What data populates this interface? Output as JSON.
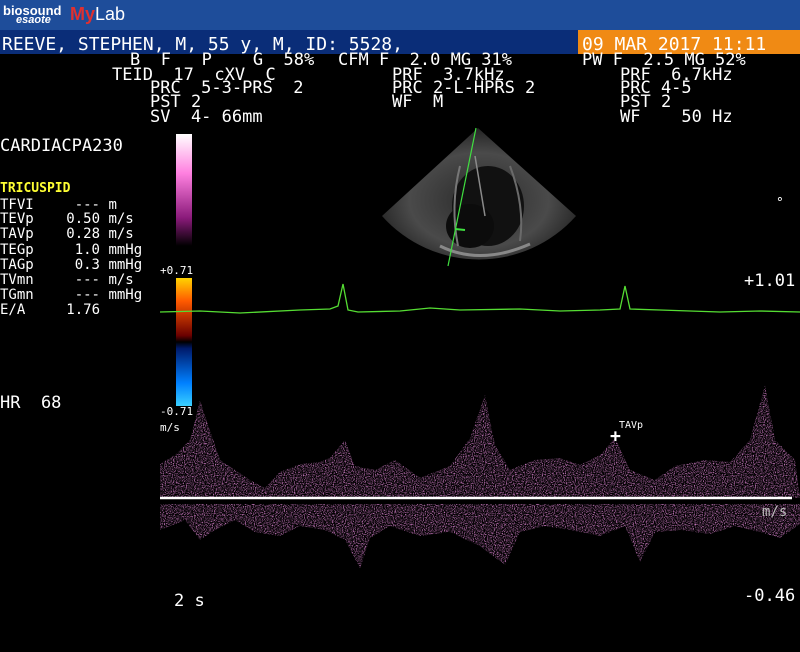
{
  "header": {
    "brand_top": "biosound",
    "brand_bottom": "esaote",
    "product_prefix": "My",
    "product_suffix": "Lab"
  },
  "patient_bar": {
    "patient_info": "REEVE, STEPHEN, M, 55 y, M, ID: 5528,",
    "datetime": "09 MAR 2017 11:11"
  },
  "params": {
    "row1_bmode": "B  F   P    G  58%",
    "row1_cfm": "CFM F  2.0 MG 31%",
    "row1_pw": "PW F  2.5 MG 52%",
    "row2_bmode": "TEID  17  cXV  C",
    "row2_cfm": "PRF  3.7kHz",
    "row2_pw": "PRF  6.7kHz",
    "row3_bmode": "PRC  5-3-PRS  2",
    "row3_cfm": "PRC 2-L-HPRS 2",
    "row3_pw": "PRC 4-5",
    "row4_bmode": "PST 2",
    "row4_cfm": "WF  M",
    "row4_pw": "PST 2",
    "row5_bmode": "SV  4- 66mm",
    "row5_pw": "WF    50 Hz"
  },
  "left_panel": {
    "probe_label": "CARDIACPA230",
    "study_label": "TRICUSPID",
    "measurements": [
      {
        "name": "TFVI",
        "value": "---",
        "unit": "m"
      },
      {
        "name": "TEVp",
        "value": "0.50",
        "unit": "m/s"
      },
      {
        "name": "TAVp",
        "value": "0.28",
        "unit": "m/s"
      },
      {
        "name": "TEGp",
        "value": "1.0",
        "unit": "mmHg"
      },
      {
        "name": "TAGp",
        "value": "0.3",
        "unit": "mmHg"
      },
      {
        "name": "TVmn",
        "value": "---",
        "unit": "m/s"
      },
      {
        "name": "TGmn",
        "value": "---",
        "unit": "mmHg"
      },
      {
        "name": "E/A",
        "value": "1.76",
        "unit": ""
      }
    ],
    "heart_rate": "HR  68"
  },
  "colorbar": {
    "max_label": "+0.71",
    "min_label": "-0.71",
    "unit_label": "m/s"
  },
  "spectral": {
    "scale_top": "+1.01",
    "scale_bottom": "-0.46",
    "scale_unit": "m/s",
    "time_scale": "2 s",
    "marker_label": "TAVp",
    "angle_marker": "°"
  },
  "colors": {
    "title_bar": "#1e4d9a",
    "patient_bar": "#0a2d78",
    "date_highlight": "#f08a14",
    "study_label": "#ffff33",
    "ecg_trace": "#55dd33",
    "doppler": "#e040c8"
  }
}
